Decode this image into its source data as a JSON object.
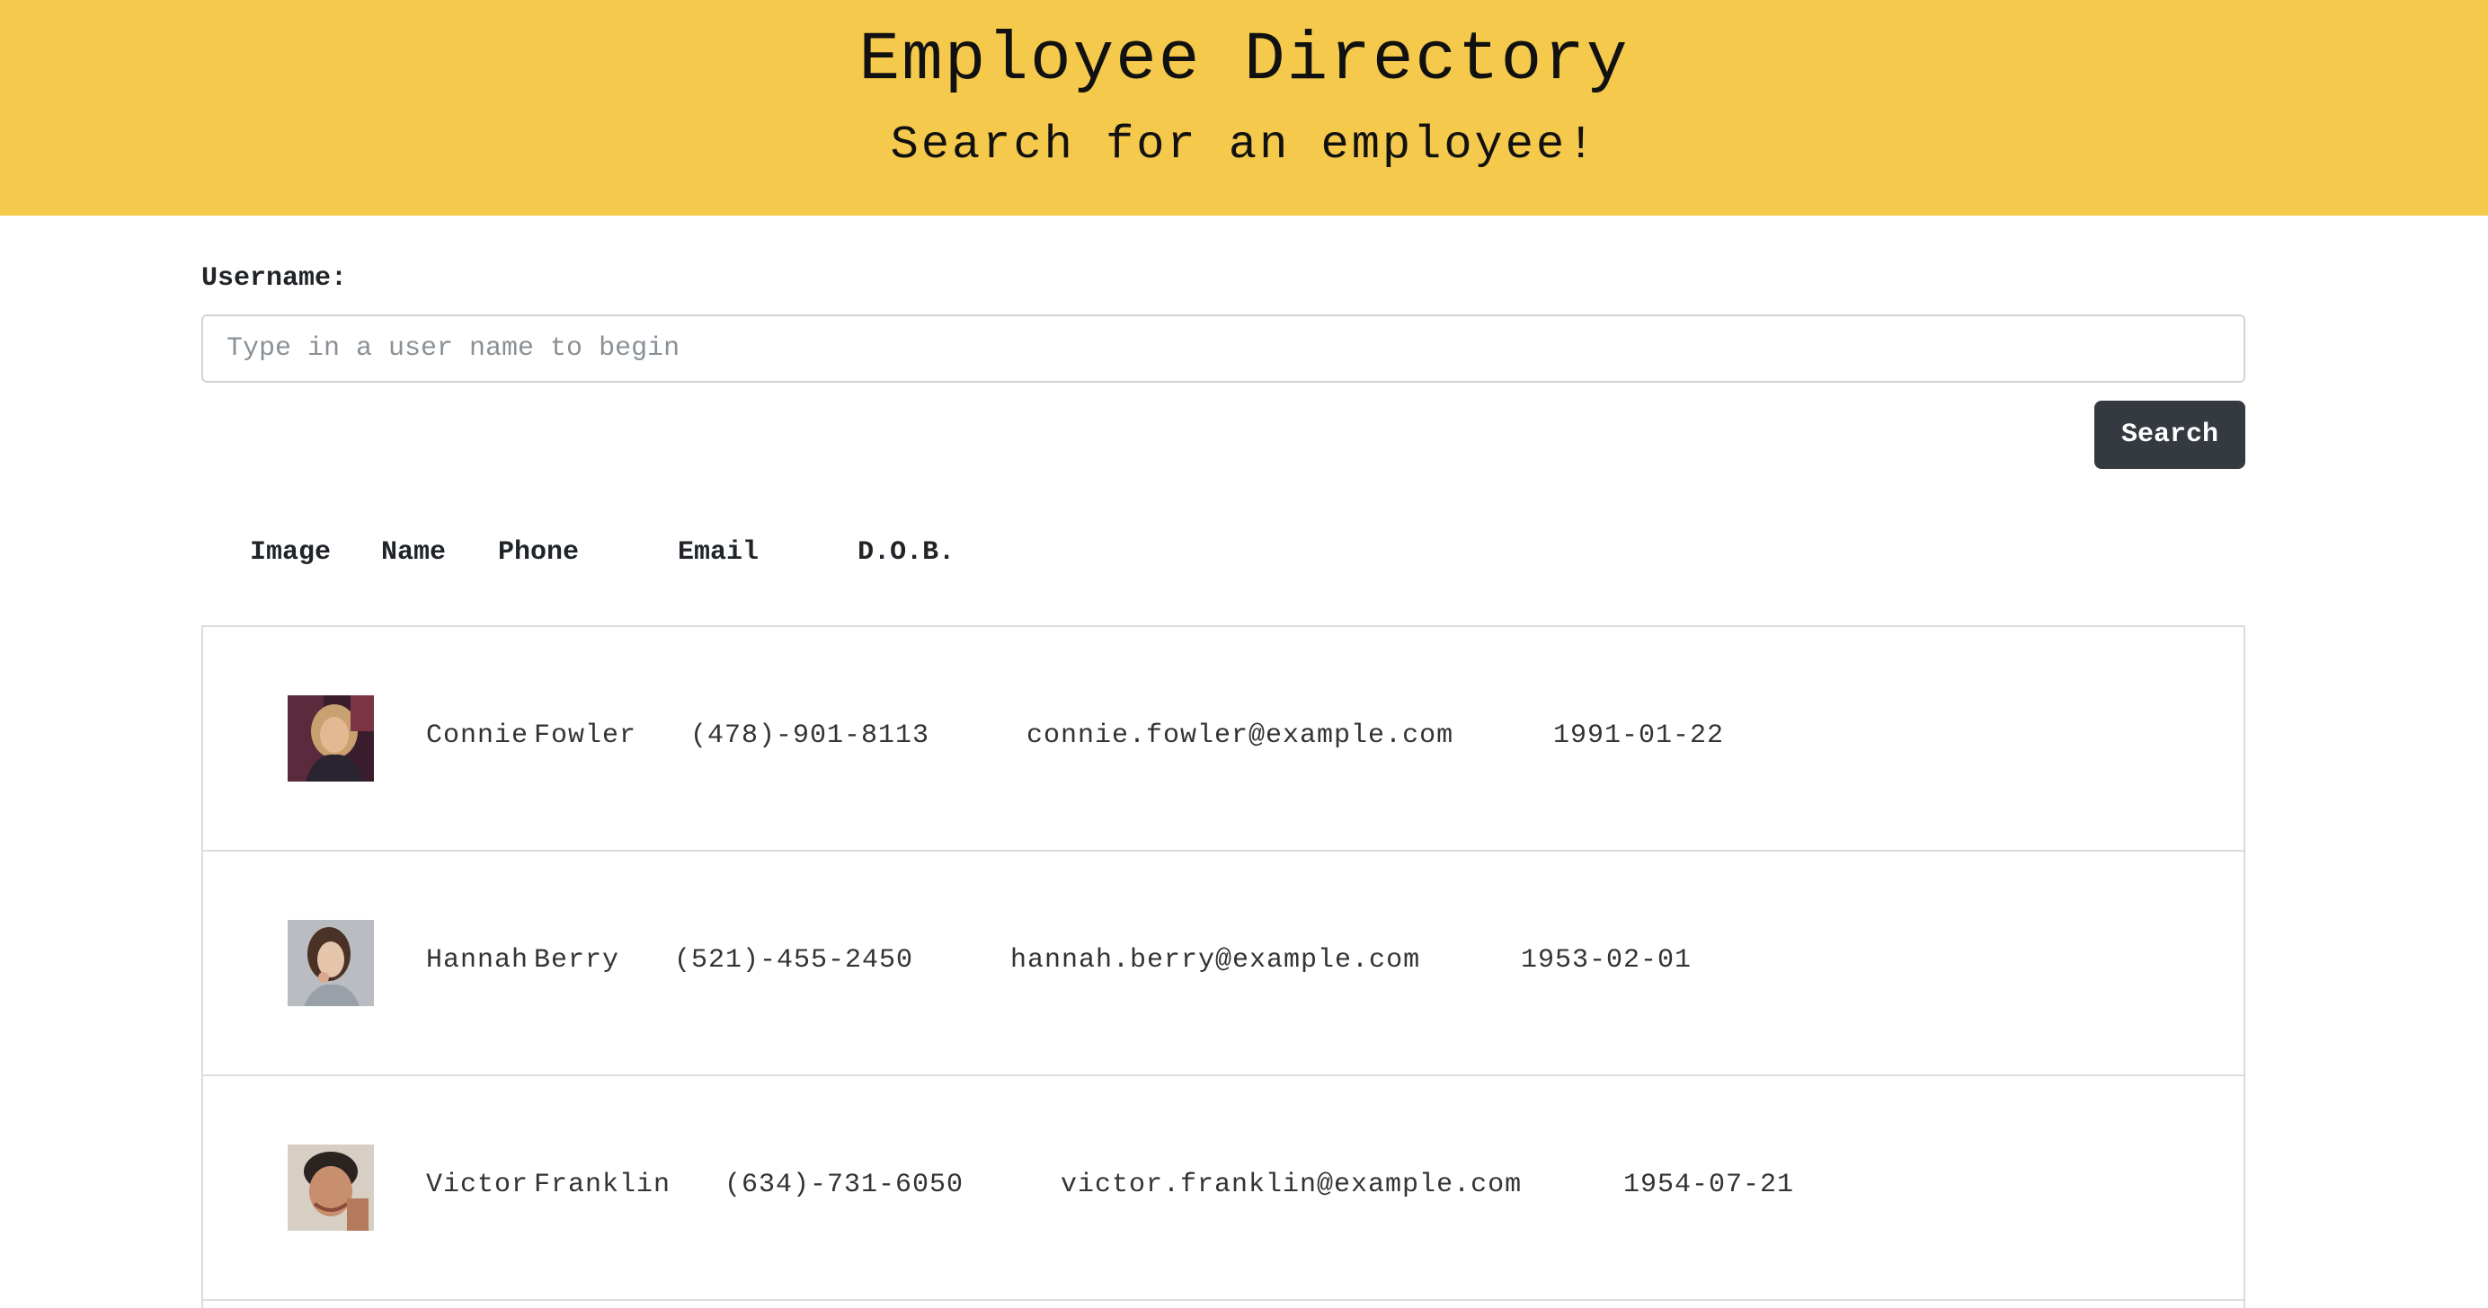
{
  "header": {
    "title": "Employee Directory",
    "subtitle": "Search for an employee!"
  },
  "search": {
    "label": "Username:",
    "placeholder": "Type in a user name to begin",
    "value": "",
    "button_label": "Search"
  },
  "table": {
    "columns": [
      "Image",
      "Name",
      "Phone",
      "Email",
      "D.O.B."
    ],
    "rows": [
      {
        "first": "Connie",
        "last": "Fowler",
        "phone": "(478)-901-8113",
        "email": "connie.fowler@example.com",
        "dob": "1991-01-22"
      },
      {
        "first": "Hannah",
        "last": "Berry",
        "phone": "(521)-455-2450",
        "email": "hannah.berry@example.com",
        "dob": "1953-02-01"
      },
      {
        "first": "Victor",
        "last": "Franklin",
        "phone": "(634)-731-6050",
        "email": "victor.franklin@example.com",
        "dob": "1954-07-21"
      }
    ]
  },
  "colors": {
    "header_bg": "#f5c94b",
    "button_bg": "#343a40"
  }
}
